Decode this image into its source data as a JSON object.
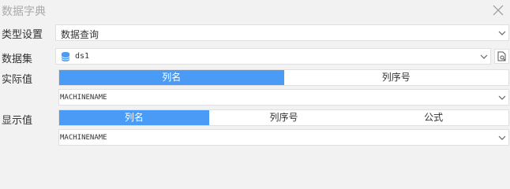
{
  "dialog": {
    "title": "数据字典"
  },
  "type_setting": {
    "label": "类型设置",
    "value": "数据查询"
  },
  "dataset": {
    "label": "数据集",
    "value": "ds1"
  },
  "actual_value": {
    "label": "实际值",
    "options": [
      "列名",
      "列序号"
    ],
    "selected": "列名",
    "field_value": "MACHINENAME"
  },
  "display_value": {
    "label": "显示值",
    "options": [
      "列名",
      "列序号",
      "公式"
    ],
    "selected": "列名",
    "field_value": "MACHINENAME"
  },
  "colors": {
    "accent": "#4a9bf5",
    "background": "#f2f2f2"
  },
  "icons": {
    "close": "close-icon",
    "dropdown": "chevron-down-icon",
    "database": "database-icon",
    "preview": "document-search-icon"
  }
}
